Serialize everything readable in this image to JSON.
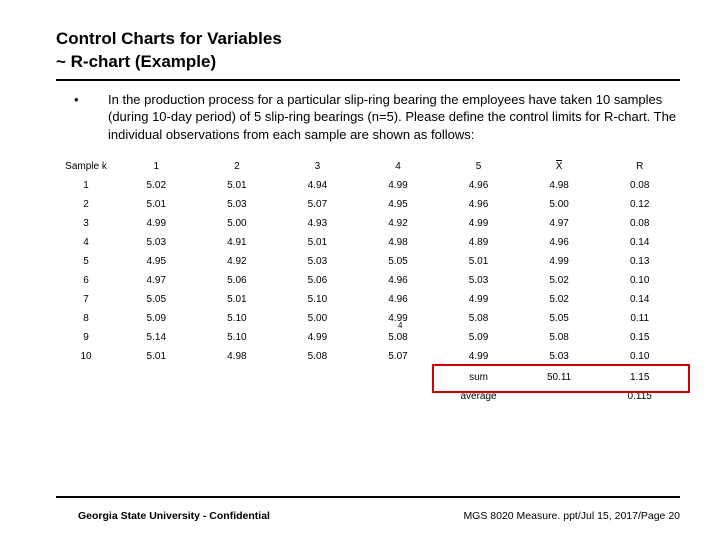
{
  "title": "Control Charts for Variables",
  "subtitle": "~ R-chart (Example)",
  "bullet_text": "In the production process for a particular slip-ring bearing the employees have taken 10 samples (during 10-day period) of 5 slip-ring bearings (n=5).  Please define the control limits for R-chart.  The individual observations from each sample are shown as follows:",
  "footer_left": "Georgia State University - Confidential",
  "footer_right": "MGS 8020 Measure. ppt/Jul 15, 2017/Page 20",
  "chart_data": {
    "type": "table",
    "headers": [
      "Sample k",
      "1",
      "2",
      "3",
      "4",
      "5",
      "X̄",
      "R"
    ],
    "rows": [
      [
        "1",
        "5.02",
        "5.01",
        "4.94",
        "4.99",
        "4.96",
        "4.98",
        "0.08"
      ],
      [
        "2",
        "5.01",
        "5.03",
        "5.07",
        "4.95",
        "4.96",
        "5.00",
        "0.12"
      ],
      [
        "3",
        "4.99",
        "5.00",
        "4.93",
        "4.92",
        "4.99",
        "4.97",
        "0.08"
      ],
      [
        "4",
        "5.03",
        "4.91",
        "5.01",
        "4.98",
        "4.89",
        "4.96",
        "0.14"
      ],
      [
        "5",
        "4.95",
        "4.92",
        "5.03",
        "5.05",
        "5.01",
        "4.99",
        "0.13"
      ],
      [
        "6",
        "4.97",
        "5.06",
        "5.06",
        "4.96",
        "5.03",
        "5.02",
        "0.10"
      ],
      [
        "7",
        "5.05",
        "5.01",
        "5.10",
        "4.96",
        "4.99",
        "5.02",
        "0.14"
      ],
      [
        "8",
        "5.09",
        "5.10",
        "5.00",
        "4.99",
        "5.08",
        "5.05",
        "0.11"
      ],
      [
        "9",
        "5.14",
        "5.10",
        "4.99",
        "5.08",
        "5.09",
        "5.08",
        "0.15"
      ],
      [
        "10",
        "5.01",
        "4.98",
        "5.08",
        "5.07",
        "4.99",
        "5.03",
        "0.10"
      ]
    ],
    "summary": {
      "sum_label": "sum",
      "sum_xbar": "50.11",
      "sum_r": "1.15",
      "avg_label": "average",
      "avg_r": "0.115"
    },
    "marker_in_row8": "4"
  }
}
